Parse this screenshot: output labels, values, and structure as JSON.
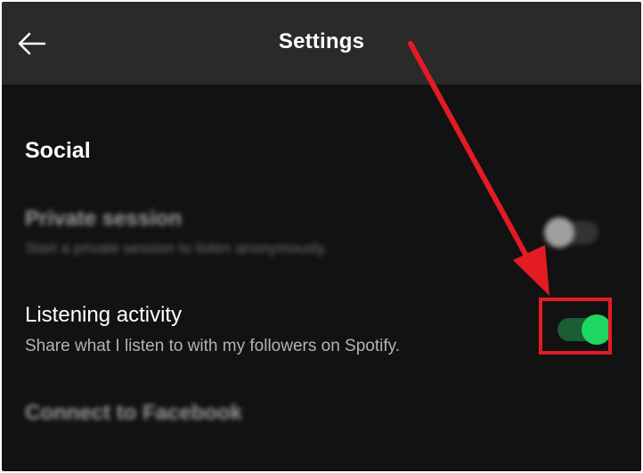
{
  "header": {
    "title": "Settings",
    "back_icon": "back-arrow-icon"
  },
  "social": {
    "section_title": "Social",
    "private_session": {
      "title": "Private session",
      "subtitle": "Start a private session to listen anonymously.",
      "enabled": false
    },
    "listening_activity": {
      "title": "Listening activity",
      "subtitle": "Share what I listen to with my followers on Spotify.",
      "enabled": true
    },
    "connect_facebook": {
      "title": "Connect to Facebook"
    }
  },
  "colors": {
    "background": "#121212",
    "header_background": "#2a2a2a",
    "toggle_on": "#1ed760",
    "annotation": "#e21b24"
  }
}
